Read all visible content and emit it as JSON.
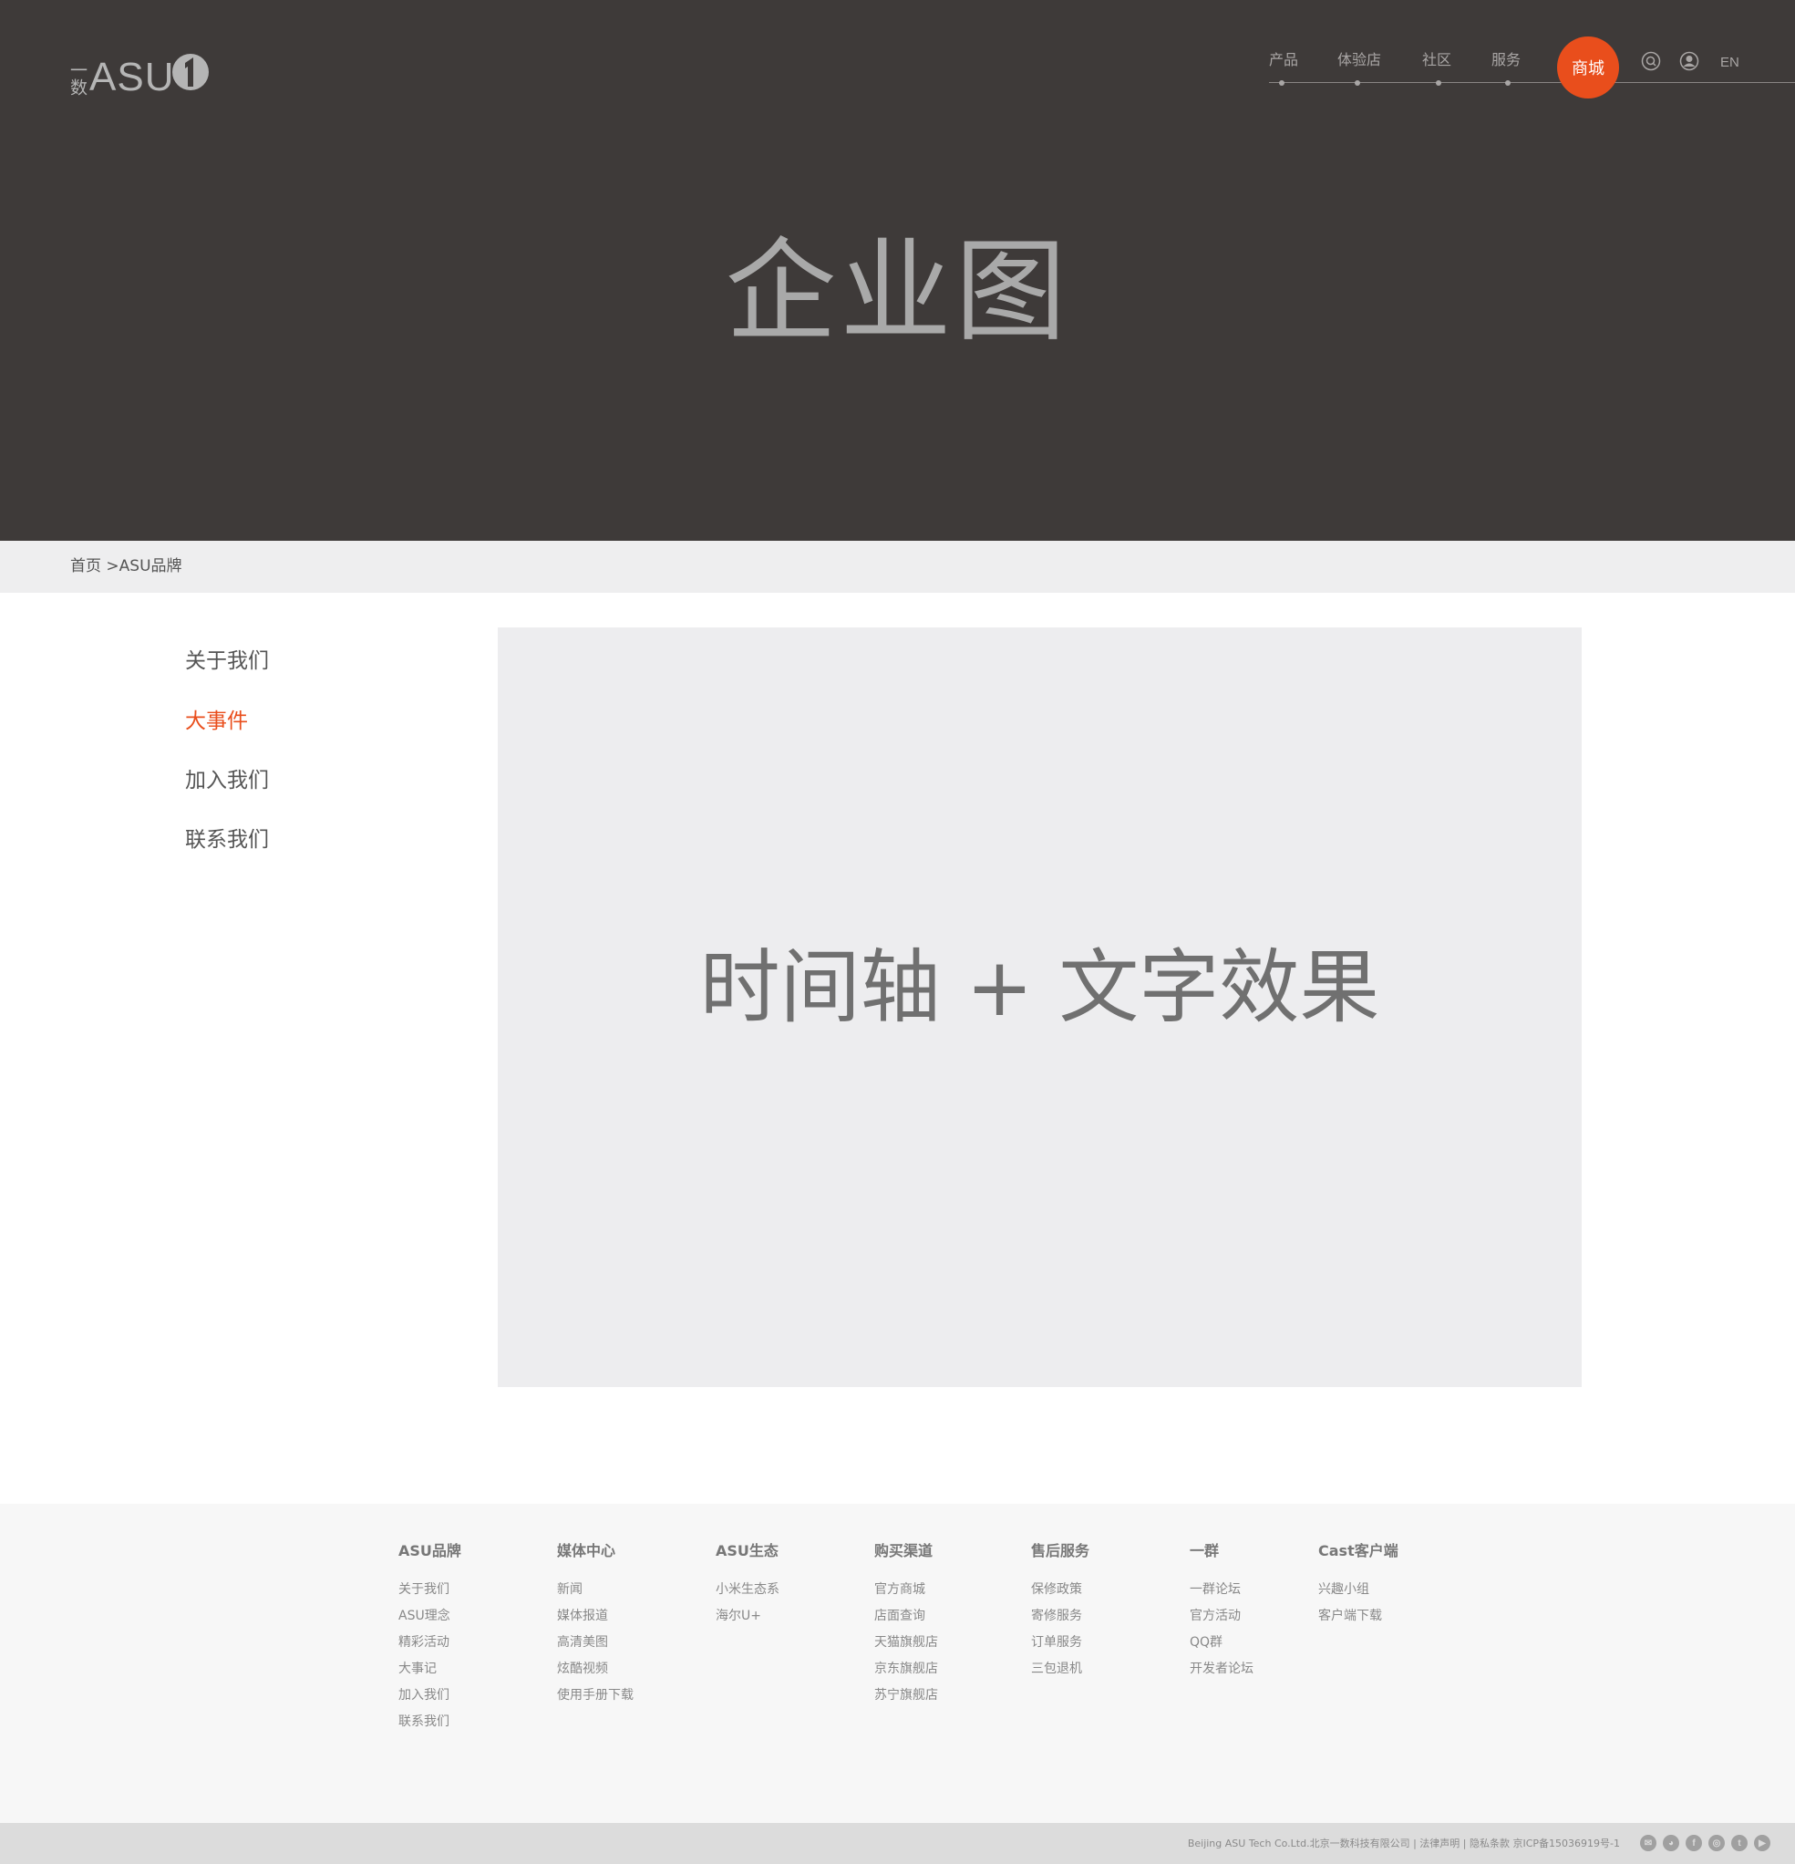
{
  "brand": {
    "logo_yi": "一数",
    "logo_text": "ASU"
  },
  "nav": {
    "items": [
      "产品",
      "体验店",
      "社区",
      "服务"
    ],
    "shop_label": "商城",
    "lang_label": "EN",
    "icons": [
      "search-icon",
      "user-icon"
    ],
    "accent_color": "#e94e1c"
  },
  "hero": {
    "title": "企业图"
  },
  "breadcrumb": {
    "text": "首页 >ASU品牌"
  },
  "side_menu": {
    "items": [
      "关于我们",
      "大事件",
      "加入我们",
      "联系我们"
    ],
    "active_index": 1
  },
  "content": {
    "placeholder": "时间轴 + 文字效果"
  },
  "footer": {
    "columns": [
      {
        "title": "ASU品牌",
        "links": [
          "关于我们",
          "ASU理念",
          "精彩活动",
          "大事记",
          "加入我们",
          "联系我们"
        ]
      },
      {
        "title": "媒体中心",
        "links": [
          "新闻",
          "媒体报道",
          "高清美图",
          "炫酷视频",
          "使用手册下载"
        ]
      },
      {
        "title": "ASU生态",
        "links": [
          "小米生态系",
          "海尔U+"
        ]
      },
      {
        "title": "购买渠道",
        "links": [
          "官方商城",
          "店面查询",
          "天猫旗舰店",
          "京东旗舰店",
          "苏宁旗舰店"
        ]
      },
      {
        "title": "售后服务",
        "links": [
          "保修政策",
          "寄修服务",
          "订单服务",
          "三包退机"
        ]
      },
      {
        "title": "一群",
        "links": [
          "一群论坛",
          "官方活动",
          "QQ群",
          "开发者论坛"
        ]
      },
      {
        "title": "Cast客户端",
        "links": [
          "兴趣小组",
          "客户端下载"
        ]
      }
    ],
    "copyright": "Beijing ASU Tech Co.Ltd.北京一数科技有限公司 | 法律声明 | 隐私条款  京ICP备15036919号-1",
    "social_icons": [
      "email-icon",
      "wechat-icon",
      "facebook-icon",
      "weibo-icon",
      "twitter-icon",
      "youku-icon"
    ]
  }
}
